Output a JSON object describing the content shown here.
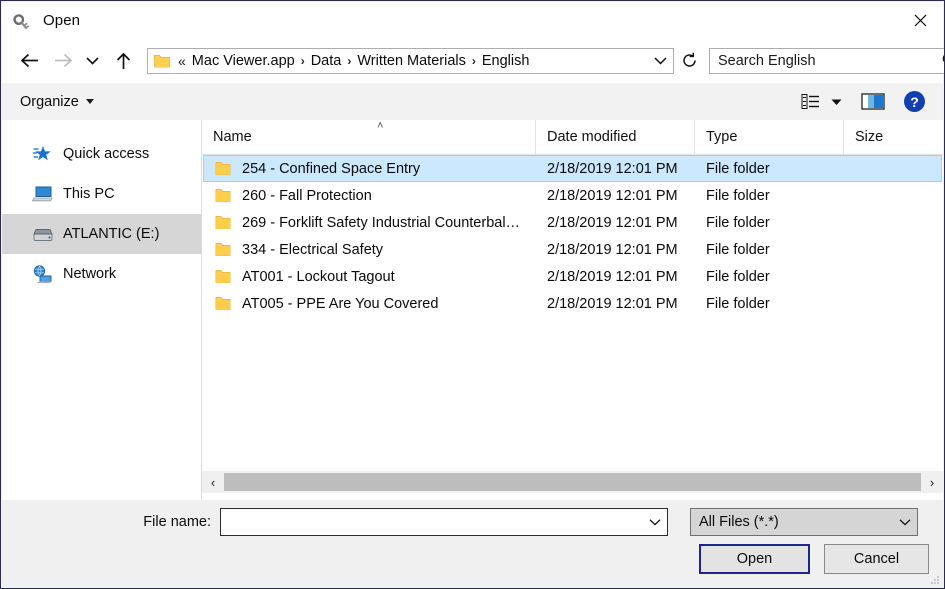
{
  "window": {
    "title": "Open",
    "title_icon": "key-icon",
    "close_label": "✕"
  },
  "nav": {
    "back_icon": "arrow-left-icon",
    "forward_icon": "arrow-right-icon",
    "recent_icon": "chevron-down-icon",
    "up_icon": "arrow-up-icon",
    "refresh_icon": "refresh-icon",
    "address_folder_icon": "folder-icon",
    "breadcrumb_lead": "«",
    "breadcrumbs": [
      "Mac Viewer.app",
      "Data",
      "Written Materials",
      "English"
    ],
    "breadcrumb_separator": "›",
    "address_chevron": "chevron-down-icon"
  },
  "search": {
    "placeholder": "Search English",
    "value": "Search English",
    "icon": "search-icon"
  },
  "toolbar": {
    "organize_label": "Organize",
    "organize_caret": "chevron-down-icon",
    "view_mode_icon": "view-details-icon",
    "view_mode_caret": "chevron-down-icon",
    "preview_pane_icon": "preview-pane-icon",
    "help_icon": "help-icon"
  },
  "sidebar": {
    "items": [
      {
        "label": "Quick access",
        "icon": "quick-access-star-icon",
        "selected": false
      },
      {
        "label": "This PC",
        "icon": "this-pc-icon",
        "selected": false
      },
      {
        "label": "ATLANTIC (E:)",
        "icon": "drive-icon",
        "selected": true
      },
      {
        "label": "Network",
        "icon": "network-icon",
        "selected": false
      }
    ]
  },
  "filelist": {
    "columns": [
      {
        "label": "Name",
        "sort": "ascending"
      },
      {
        "label": "Date modified",
        "sort": ""
      },
      {
        "label": "Type",
        "sort": ""
      },
      {
        "label": "Size",
        "sort": ""
      }
    ],
    "sort_caret": "˄",
    "rows": [
      {
        "name": "254 - Confined Space Entry",
        "date": "2/18/2019 12:01 PM",
        "type": "File folder",
        "size": "",
        "icon": "folder-icon",
        "selected": true
      },
      {
        "name": "260 - Fall Protection",
        "date": "2/18/2019 12:01 PM",
        "type": "File folder",
        "size": "",
        "icon": "folder-icon",
        "selected": false
      },
      {
        "name": "269 - Forklift Safety Industrial Counterbal…",
        "date": "2/18/2019 12:01 PM",
        "type": "File folder",
        "size": "",
        "icon": "folder-icon",
        "selected": false
      },
      {
        "name": "334 - Electrical Safety",
        "date": "2/18/2019 12:01 PM",
        "type": "File folder",
        "size": "",
        "icon": "folder-icon",
        "selected": false
      },
      {
        "name": "AT001 - Lockout Tagout",
        "date": "2/18/2019 12:01 PM",
        "type": "File folder",
        "size": "",
        "icon": "folder-icon",
        "selected": false
      },
      {
        "name": "AT005 - PPE Are You Covered",
        "date": "2/18/2019 12:01 PM",
        "type": "File folder",
        "size": "",
        "icon": "folder-icon",
        "selected": false
      }
    ],
    "scrollbar": {
      "left_arrow": "‹",
      "right_arrow": "›"
    }
  },
  "bottom": {
    "filename_label": "File name:",
    "filename_value": "",
    "filename_caret": "chevron-down-icon",
    "filter_value": "All Files (*.*)",
    "filter_caret": "chevron-down-icon",
    "open_label": "Open",
    "cancel_label": "Cancel"
  },
  "colors": {
    "selection_fill": "#cce8ff",
    "selection_border": "#99d1ff",
    "sidebar_selection": "#d6d6d6",
    "folder_yellow": "#ffc94d",
    "accent_blue": "#0b5fc4",
    "default_button_border": "#23238e"
  }
}
